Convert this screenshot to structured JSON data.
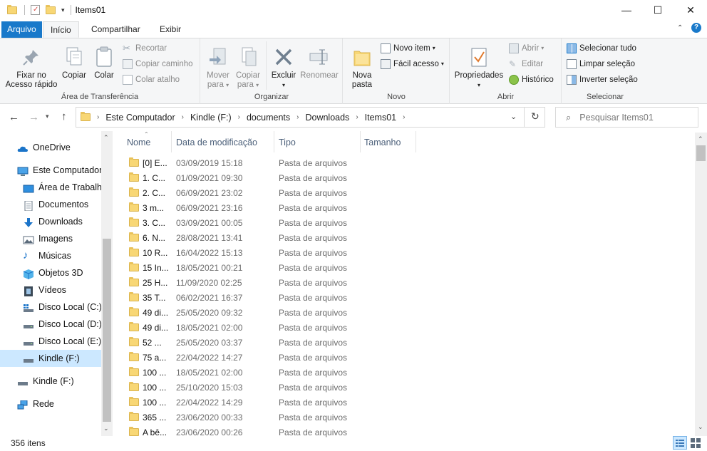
{
  "window": {
    "title": "Items01",
    "controls": {
      "minimize": "—",
      "maximize": "☐",
      "close": "✕"
    }
  },
  "tabs": {
    "file": "Arquivo",
    "home": "Início",
    "share": "Compartilhar",
    "view": "Exibir"
  },
  "ribbon": {
    "clipboard": {
      "label": "Área de Transferência",
      "pin": "Fixar no\nAcesso rápido",
      "pin_l1": "Fixar no",
      "pin_l2": "Acesso rápido",
      "copy": "Copiar",
      "paste": "Colar",
      "cut": "Recortar",
      "copy_path": "Copiar caminho",
      "paste_shortcut": "Colar atalho"
    },
    "organize": {
      "label": "Organizar",
      "move_l1": "Mover",
      "move_l2": "para",
      "copy_l1": "Copiar",
      "copy_l2": "para",
      "delete": "Excluir",
      "rename": "Renomear"
    },
    "new": {
      "label": "Novo",
      "folder_l1": "Nova",
      "folder_l2": "pasta",
      "new_item": "Novo item",
      "easy_access": "Fácil acesso"
    },
    "open": {
      "label": "Abrir",
      "properties": "Propriedades",
      "open": "Abrir",
      "edit": "Editar",
      "history": "Histórico"
    },
    "select": {
      "label": "Selecionar",
      "select_all": "Selecionar tudo",
      "select_none": "Limpar seleção",
      "invert": "Inverter seleção"
    }
  },
  "address": {
    "crumbs": [
      "Este Computador",
      "Kindle (F:)",
      "documents",
      "Downloads",
      "Items01"
    ]
  },
  "search": {
    "placeholder": "Pesquisar Items01"
  },
  "sidebar": {
    "items": [
      {
        "label": "OneDrive",
        "icon": "cloud-icon"
      },
      {
        "label": "Este Computador",
        "icon": "computer-icon"
      },
      {
        "label": "Área de Trabalho",
        "icon": "desktop-icon"
      },
      {
        "label": "Documentos",
        "icon": "documents-icon"
      },
      {
        "label": "Downloads",
        "icon": "download-arrow-icon"
      },
      {
        "label": "Imagens",
        "icon": "pictures-icon"
      },
      {
        "label": "Músicas",
        "icon": "music-note-icon"
      },
      {
        "label": "Objetos 3D",
        "icon": "cube-icon"
      },
      {
        "label": "Vídeos",
        "icon": "film-icon"
      },
      {
        "label": "Disco Local (C:)",
        "icon": "windows-drive-icon"
      },
      {
        "label": "Disco Local (D:)",
        "icon": "drive-icon"
      },
      {
        "label": "Disco Local (E:)",
        "icon": "drive-icon"
      },
      {
        "label": "Kindle (F:)",
        "icon": "drive-icon"
      },
      {
        "label": "Kindle (F:)",
        "icon": "drive-icon"
      },
      {
        "label": "Rede",
        "icon": "network-icon"
      }
    ]
  },
  "columns": {
    "name": "Nome",
    "date": "Data de modificação",
    "type": "Tipo",
    "size": "Tamanho"
  },
  "files": [
    {
      "name": "[0] E...",
      "date": "03/09/2019 15:18",
      "type": "Pasta de arquivos"
    },
    {
      "name": "1. C...",
      "date": "01/09/2021 09:30",
      "type": "Pasta de arquivos"
    },
    {
      "name": "2. C...",
      "date": "06/09/2021 23:02",
      "type": "Pasta de arquivos"
    },
    {
      "name": "3 m...",
      "date": "06/09/2021 23:16",
      "type": "Pasta de arquivos"
    },
    {
      "name": "3. C...",
      "date": "03/09/2021 00:05",
      "type": "Pasta de arquivos"
    },
    {
      "name": "6. N...",
      "date": "28/08/2021 13:41",
      "type": "Pasta de arquivos"
    },
    {
      "name": "10 R...",
      "date": "16/04/2022 15:13",
      "type": "Pasta de arquivos"
    },
    {
      "name": "15 In...",
      "date": "18/05/2021 00:21",
      "type": "Pasta de arquivos"
    },
    {
      "name": "25 H...",
      "date": "11/09/2020 02:25",
      "type": "Pasta de arquivos"
    },
    {
      "name": "35 T...",
      "date": "06/02/2021 16:37",
      "type": "Pasta de arquivos"
    },
    {
      "name": "49 di...",
      "date": "25/05/2020 09:32",
      "type": "Pasta de arquivos"
    },
    {
      "name": "49 di...",
      "date": "18/05/2021 02:00",
      "type": "Pasta de arquivos"
    },
    {
      "name": "52 ...",
      "date": "25/05/2020 03:37",
      "type": "Pasta de arquivos"
    },
    {
      "name": "75 a...",
      "date": "22/04/2022 14:27",
      "type": "Pasta de arquivos"
    },
    {
      "name": "100 ...",
      "date": "18/05/2021 02:00",
      "type": "Pasta de arquivos"
    },
    {
      "name": "100 ...",
      "date": "25/10/2020 15:03",
      "type": "Pasta de arquivos"
    },
    {
      "name": "100 ...",
      "date": "22/04/2022 14:29",
      "type": "Pasta de arquivos"
    },
    {
      "name": "365 ...",
      "date": "23/06/2020 00:33",
      "type": "Pasta de arquivos"
    },
    {
      "name": "A bê...",
      "date": "23/06/2020 00:26",
      "type": "Pasta de arquivos"
    }
  ],
  "status": {
    "count": "356 itens"
  },
  "colors": {
    "accent": "#1979ca",
    "selected": "#cce8ff",
    "folder": "#f8d775"
  }
}
